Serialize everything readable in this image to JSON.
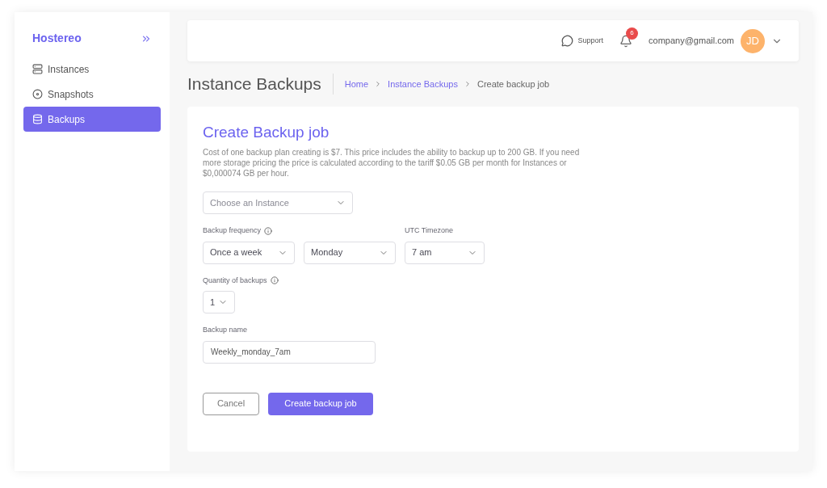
{
  "sidebar": {
    "brand": "Hostereo",
    "items": [
      {
        "label": "Instances",
        "kind": "server",
        "selected": false
      },
      {
        "label": "Snapshots",
        "kind": "disc",
        "selected": false
      },
      {
        "label": "Backups",
        "kind": "database",
        "selected": true
      }
    ]
  },
  "header": {
    "support": "Support",
    "notifications": "6",
    "email": "company@gmail.com",
    "avatar": "JD"
  },
  "page_title": "Instance Backups",
  "breadcrumbs": [
    {
      "label": "Home",
      "current": false
    },
    {
      "label": "Instance Backups",
      "current": false
    },
    {
      "label": "Create backup job",
      "current": true
    }
  ],
  "form": {
    "title": "Create Backup job",
    "description": "Cost of one backup plan creating is $7. This price includes the ability to backup up to 200 GB. If you need more storage pricing the price is calculated according to the tariff $0.05 GB per month for Instances or $0,000074 GB per hour.",
    "instance": {
      "placeholder": "Choose an Instance"
    },
    "frequency": {
      "label": "Backup frequency",
      "period": "Once a week",
      "day": "Monday"
    },
    "timezone": {
      "label": "UTC Timezone",
      "value": "7 am"
    },
    "quantity": {
      "label": "Quantity of backups",
      "value": "1"
    },
    "name": {
      "label": "Backup name",
      "value": "Weekly_monday_7am"
    },
    "buttons": {
      "cancel": "Cancel",
      "submit": "Create backup job"
    }
  }
}
